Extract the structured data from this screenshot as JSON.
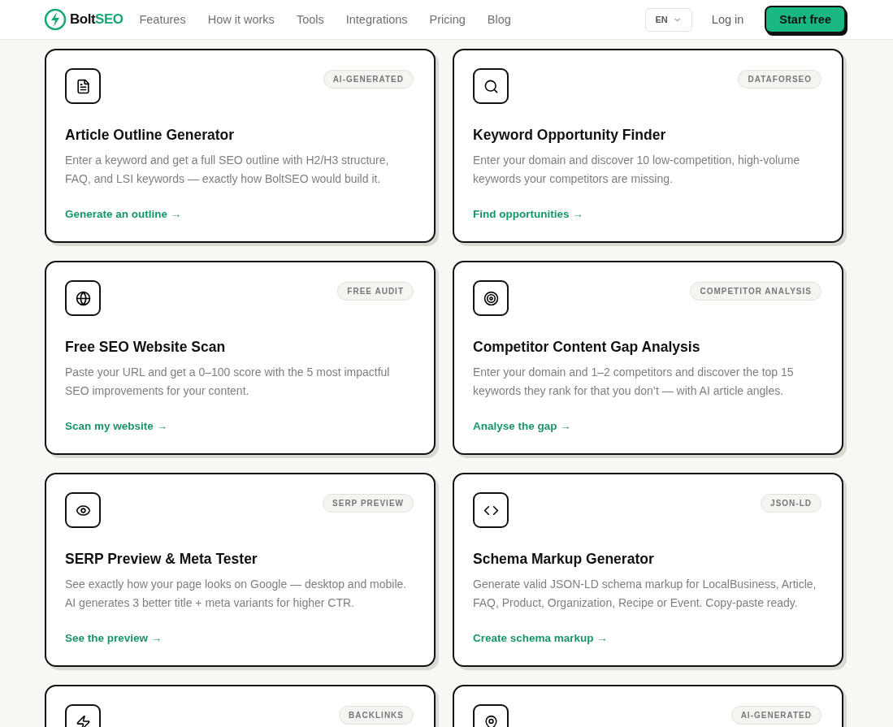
{
  "header": {
    "logo": {
      "name": "Bolt",
      "accent": "SEO"
    },
    "nav": [
      "Features",
      "How it works",
      "Tools",
      "Integrations",
      "Pricing",
      "Blog"
    ],
    "language": "EN",
    "login": "Log in",
    "cta": "Start free"
  },
  "cards": [
    {
      "badge": "AI-GENERATED",
      "title": "Article Outline Generator",
      "description": "Enter a keyword and get a full SEO outline with H2/H3 structure, FAQ, and LSI keywords — exactly how BoltSEO would build it.",
      "link": "Generate an outline →"
    },
    {
      "badge": "DATAFORSEO",
      "title": "Keyword Opportunity Finder",
      "description": "Enter your domain and discover 10 low-competition, high-volume keywords your competitors are missing.",
      "link": "Find opportunities →"
    },
    {
      "badge": "FREE AUDIT",
      "title": "Free SEO Website Scan",
      "description": "Paste your URL and get a 0–100 score with the 5 most impactful SEO improvements for your content.",
      "link": "Scan my website →"
    },
    {
      "badge": "COMPETITOR ANALYSIS",
      "title": "Competitor Content Gap Analysis",
      "description": "Enter your domain and 1–2 competitors and discover the top 15 keywords they rank for that you don’t — with AI article angles.",
      "link": "Analyse the gap →"
    },
    {
      "badge": "SERP PREVIEW",
      "title": "SERP Preview & Meta Tester",
      "description": "See exactly how your page looks on Google — desktop and mobile. AI generates 3 better title + meta variants for higher CTR.",
      "link": "See the preview →"
    },
    {
      "badge": "JSON-LD",
      "title": "Schema Markup Generator",
      "description": "Generate valid JSON-LD schema markup for LocalBusiness, Article, FAQ, Product, Organization, Recipe or Event. Copy-paste ready.",
      "link": "Create schema markup →"
    },
    {
      "badge": "BACKLINKS"
    },
    {
      "badge": "AI-GENERATED"
    }
  ]
}
